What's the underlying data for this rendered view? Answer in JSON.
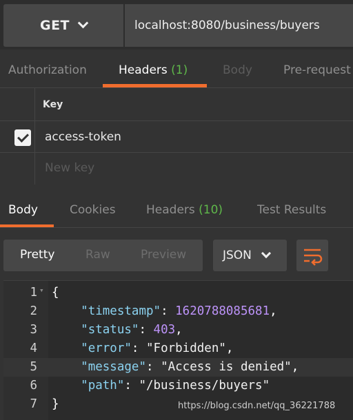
{
  "request": {
    "method": "GET",
    "url": "localhost:8080/business/buyers"
  },
  "request_tabs": [
    {
      "label": "Authorization"
    },
    {
      "label": "Headers",
      "count": "(1)"
    },
    {
      "label": "Body"
    },
    {
      "label": "Pre-request"
    }
  ],
  "headers_table": {
    "key_column": "Key",
    "rows": [
      {
        "key": "access-token",
        "checked": true
      }
    ],
    "new_key_placeholder": "New key"
  },
  "response_tabs": [
    {
      "label": "Body"
    },
    {
      "label": "Cookies"
    },
    {
      "label": "Headers",
      "count": "(10)"
    },
    {
      "label": "Test Results"
    }
  ],
  "response_view": {
    "modes": [
      "Pretty",
      "Raw",
      "Preview"
    ],
    "active_mode": "Pretty",
    "format": "JSON",
    "wrap_icon": "wrap-lines-icon"
  },
  "code_lines": [
    {
      "n": "1",
      "text": "{"
    },
    {
      "n": "2",
      "key": "\"timestamp\"",
      "value": "1620788085681",
      "value_type": "number"
    },
    {
      "n": "3",
      "key": "\"status\"",
      "value": "403",
      "value_type": "number"
    },
    {
      "n": "4",
      "key": "\"error\"",
      "value": "\"Forbidden\"",
      "value_type": "string"
    },
    {
      "n": "5",
      "key": "\"message\"",
      "value": "\"Access is denied\"",
      "value_type": "string"
    },
    {
      "n": "6",
      "key": "\"path\"",
      "value": "\"/business/buyers\"",
      "value_type": "string"
    },
    {
      "n": "7",
      "text": "}"
    }
  ],
  "watermark": "https://blog.csdn.net/qq_36221788",
  "colors": {
    "accent": "#f06d2e",
    "count_green": "#5fb84a",
    "json_key": "#8bd2f0",
    "json_number": "#bd93f9"
  }
}
